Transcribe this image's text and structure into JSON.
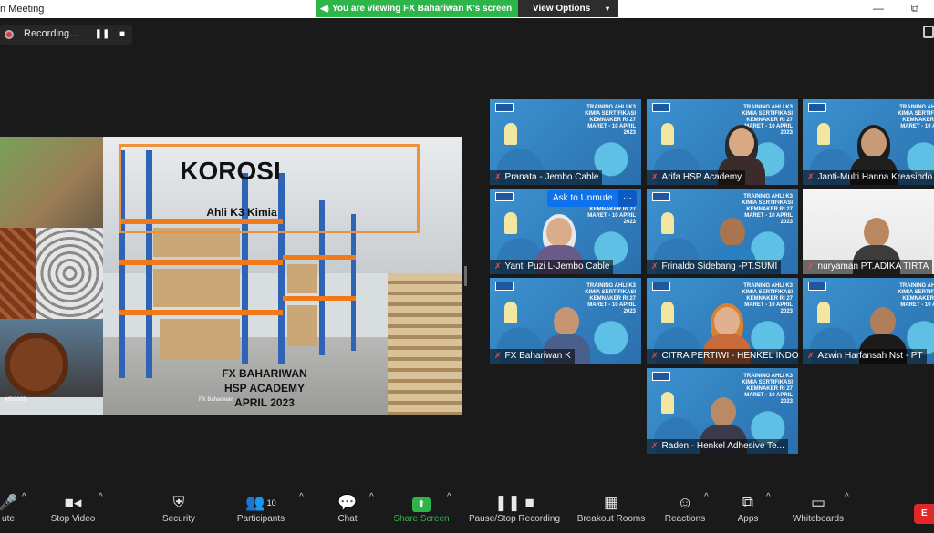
{
  "window": {
    "title": "n Meeting",
    "minimize_glyph": "—",
    "restore_glyph": "⧉"
  },
  "share_banner": {
    "text": "You are viewing FX Bahariwan K's screen",
    "speaker_glyph": "◀)"
  },
  "view_options": {
    "label": "View Options",
    "chevron": "▾"
  },
  "recording": {
    "label": "Recording...",
    "pause_glyph": "❚❚",
    "stop_glyph": "■"
  },
  "slide": {
    "title": "KOROSI",
    "subtitle": "Ahli K3 Kimia",
    "presenter_lines": [
      "FX BAHARIWAN",
      "HSP ACADEMY",
      "APRIL 2023"
    ],
    "footer_date": "4/5/2023",
    "footer_name": "FX Bahariwan"
  },
  "poster_text": "TRAINING AHLI K3 KIMIA SERTIFIKASI KEMNAKER RI 27 MARET - 10 APRIL 2023",
  "unmute": {
    "label": "Ask to Unmute",
    "more": "···"
  },
  "participants": [
    {
      "name": "Pranata - Jembo Cable",
      "video": false
    },
    {
      "name": "Arifa HSP Academy",
      "video": true
    },
    {
      "name": "Janti-Multi Hanna Kreasindo",
      "video": true
    },
    {
      "name": "Yanti Puzi L-Jembo Cable",
      "video": true
    },
    {
      "name": "Frinaldo Sidebang -PT.SUMI",
      "video": true
    },
    {
      "name": "nuryaman PT.ADIKA TIRTA",
      "video": true
    },
    {
      "name": "FX Bahariwan K",
      "video": true
    },
    {
      "name": "CITRA PERTIWI - HENKEL INDO",
      "video": true
    },
    {
      "name": "Azwin Harfansah Nst - PT",
      "video": true
    },
    {
      "name": "Raden - Henkel Adhesive Te...",
      "video": true
    }
  ],
  "toolbar": {
    "mute": "ute",
    "stop_video": "Stop Video",
    "security": "Security",
    "participants": "Participants",
    "participants_count": "10",
    "chat": "Chat",
    "share_screen": "Share Screen",
    "pause_recording": "Pause/Stop Recording",
    "breakout": "Breakout Rooms",
    "reactions": "Reactions",
    "apps": "Apps",
    "whiteboards": "Whiteboards",
    "end": "E"
  },
  "colors": {
    "share_green": "#2db54a",
    "accent_blue": "#0e72ed",
    "active_speaker": "#e6d33a",
    "end_red": "#e02828"
  }
}
